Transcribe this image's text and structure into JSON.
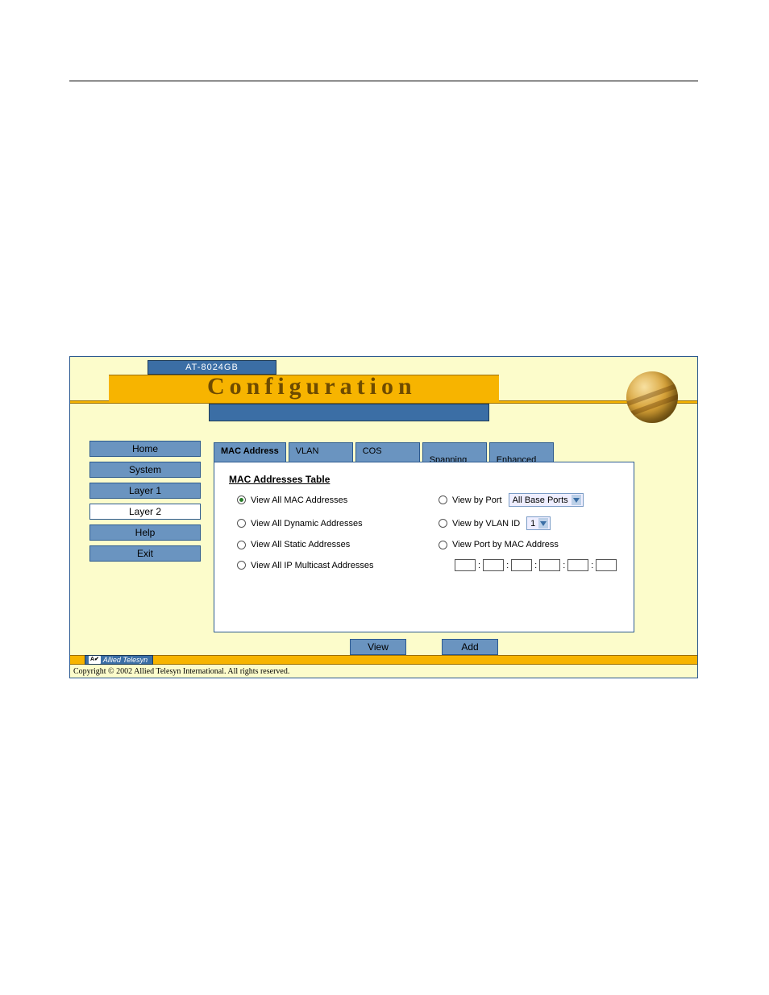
{
  "header": {
    "device_model": "AT-8024GB",
    "title": "Configuration"
  },
  "sidebar": {
    "items": [
      {
        "label": "Home",
        "active": false
      },
      {
        "label": "System",
        "active": false
      },
      {
        "label": "Layer 1",
        "active": false
      },
      {
        "label": "Layer 2",
        "active": true
      },
      {
        "label": "Help",
        "active": false
      },
      {
        "label": "Exit",
        "active": false
      }
    ]
  },
  "tabs": [
    {
      "label": "MAC Address",
      "active": true
    },
    {
      "label": "VLAN",
      "active": false
    },
    {
      "label": "COS",
      "active": false
    },
    {
      "label": "Spanning\nTree",
      "active": false
    },
    {
      "label": "Enhanced\nStacking",
      "active": false
    }
  ],
  "panel": {
    "title": "MAC Addresses Table",
    "radios": {
      "view_all_mac": "View All MAC Addresses",
      "view_all_dynamic": "View All Dynamic Addresses",
      "view_all_static": "View All Static Addresses",
      "view_all_multicast": "View All IP Multicast Addresses",
      "view_by_port": "View by Port",
      "view_by_vlan": "View by VLAN ID",
      "view_port_by_mac": "View Port by MAC Address"
    },
    "selected_radio": "view_all_mac",
    "port_select_value": "All Base Ports",
    "vlan_select_value": "1"
  },
  "buttons": {
    "view": "View",
    "add": "Add"
  },
  "footer": {
    "brand": "Allied Telesyn",
    "copyright": "Copyright © 2002 Allied Telesyn International. All rights reserved."
  }
}
